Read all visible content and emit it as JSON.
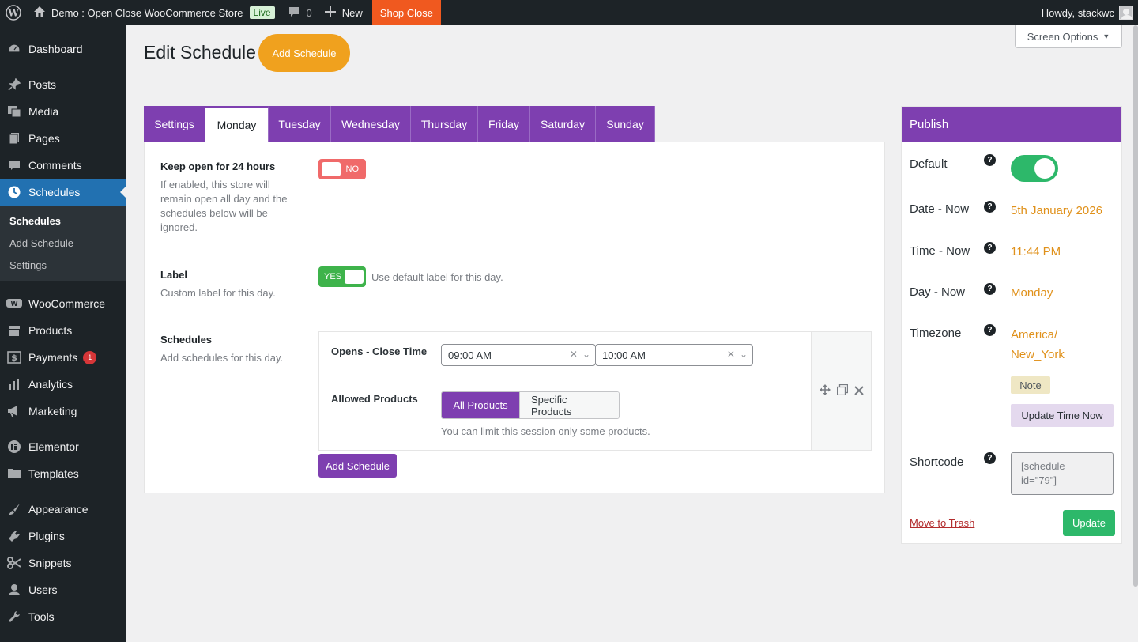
{
  "adminbar": {
    "site_name": "Demo : Open Close WooCommerce Store",
    "live_badge": "Live",
    "comment_count": "0",
    "new_label": "New",
    "shop_status": "Shop Close",
    "greeting": "Howdy, stackwc"
  },
  "sidebar": {
    "items": [
      {
        "label": "Dashboard",
        "icon": "dashboard-icon"
      },
      {
        "label": "Posts",
        "icon": "pin-icon"
      },
      {
        "label": "Media",
        "icon": "media-icon"
      },
      {
        "label": "Pages",
        "icon": "pages-icon"
      },
      {
        "label": "Comments",
        "icon": "comment-icon"
      },
      {
        "label": "Schedules",
        "icon": "clock-icon"
      },
      {
        "label": "WooCommerce",
        "icon": "woocommerce-icon"
      },
      {
        "label": "Products",
        "icon": "archive-icon"
      },
      {
        "label": "Payments",
        "icon": "dollar-icon",
        "badge": "1"
      },
      {
        "label": "Analytics",
        "icon": "chart-bar-icon"
      },
      {
        "label": "Marketing",
        "icon": "megaphone-icon"
      },
      {
        "label": "Elementor",
        "icon": "elementor-icon"
      },
      {
        "label": "Templates",
        "icon": "folder-icon"
      },
      {
        "label": "Appearance",
        "icon": "brush-icon"
      },
      {
        "label": "Plugins",
        "icon": "plug-icon"
      },
      {
        "label": "Snippets",
        "icon": "scissors-icon"
      },
      {
        "label": "Users",
        "icon": "user-icon"
      },
      {
        "label": "Tools",
        "icon": "wrench-icon"
      }
    ],
    "submenu": [
      "Schedules",
      "Add Schedule",
      "Settings"
    ]
  },
  "header": {
    "screen_options": "Screen Options",
    "title": "Edit Schedule",
    "add_button": "Add Schedule"
  },
  "tabs": [
    "Settings",
    "Monday",
    "Tuesday",
    "Wednesday",
    "Thursday",
    "Friday",
    "Saturday",
    "Sunday"
  ],
  "active_tab": "Monday",
  "form": {
    "keep_open": {
      "label": "Keep open for 24 hours",
      "desc": "If enabled, this store will remain open all day and the schedules below will be ignored.",
      "toggle": "NO"
    },
    "label_field": {
      "label": "Label",
      "desc": "Custom label for this day.",
      "toggle": "YES",
      "hint": "Use default label for this day."
    },
    "schedules": {
      "label": "Schedules",
      "desc": "Add schedules for this day.",
      "time_label": "Opens - Close Time",
      "open_time": "09:00 AM",
      "close_time": "10:00 AM",
      "products_label": "Allowed Products",
      "all_products": "All Products",
      "specific_products": "Specific Products",
      "products_hint": "You can limit this session only some products.",
      "add_button": "Add Schedule"
    }
  },
  "publish": {
    "title": "Publish",
    "default_label": "Default",
    "date_label": "Date - Now",
    "date_value": "5th January 2026",
    "time_label": "Time - Now",
    "time_value": "11:44 PM",
    "day_label": "Day - Now",
    "day_value": "Monday",
    "timezone_label": "Timezone",
    "timezone_line1": "America/",
    "timezone_line2": "New_York",
    "note": "Note",
    "update_time": "Update Time Now",
    "shortcode_label": "Shortcode",
    "shortcode_line1": "[schedule",
    "shortcode_line2": "id=\"79\"]",
    "trash": "Move to Trash",
    "update": "Update",
    "help_glyph": "?"
  },
  "colors": {
    "accent_purple": "#7e3fb0",
    "orange": "#f0a11e",
    "green": "#2db86a",
    "shop_close": "#f0591f",
    "wp_blue": "#2271b1"
  }
}
